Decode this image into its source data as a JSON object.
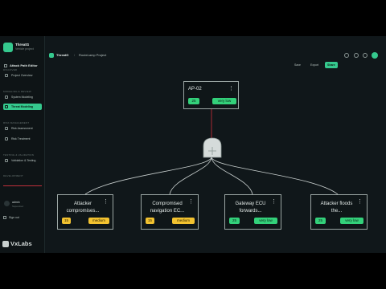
{
  "app": {
    "name": "ThreatG",
    "workspace": "Vehicle project"
  },
  "sidebar": {
    "sections": [
      {
        "label": "DISCOVER",
        "items": [
          {
            "label": "Project Overview",
            "icon": "grid-icon"
          }
        ]
      },
      {
        "label": "MODELING & REVIEW",
        "items": [
          {
            "label": "System Modeling",
            "icon": "cube-icon"
          },
          {
            "label": "Threat Modeling",
            "icon": "shield-icon",
            "active": true
          }
        ]
      },
      {
        "label": "RISK MANAGEMENT",
        "items": [
          {
            "label": "Risk Assessment",
            "icon": "chart-icon"
          },
          {
            "label": "Risk Treatment",
            "icon": "check-icon"
          }
        ]
      },
      {
        "label": "TESTING & VALIDATION",
        "items": [
          {
            "label": "Validation & Testing",
            "icon": "flask-icon"
          }
        ]
      },
      {
        "label": "DEVELOPMENT",
        "items": []
      }
    ],
    "user": {
      "name": "admin",
      "role": "Supervisor"
    },
    "signout": "Sign out"
  },
  "topbar": {
    "app": "ThreatG",
    "separator": "/",
    "project": "RouteLamp Project"
  },
  "editor": {
    "title": "Attack Path Editor",
    "buttons": {
      "save": "Save",
      "export": "Export",
      "share": "Share"
    }
  },
  "nodes": {
    "root": {
      "title": "AP-02",
      "score": "25",
      "rating": "very low"
    },
    "children": [
      {
        "title_line1": "Attacker",
        "title_line2": "compromises...",
        "score": "15",
        "rating": "medium"
      },
      {
        "title_line1": "Compromised",
        "title_line2": "navigation EC...",
        "score": "15",
        "rating": "medium"
      },
      {
        "title_line1": "Gateway ECU",
        "title_line2": "forwards...",
        "score": "25",
        "rating": "very low"
      },
      {
        "title_line1": "Attacker floods",
        "title_line2": "the...",
        "score": "25",
        "rating": "very low"
      }
    ],
    "gate": {
      "type": "and-gate-icon"
    },
    "menu_glyph": "⋮"
  },
  "watermark": "VxLabs",
  "colors": {
    "accent": "#35c98e",
    "medium": "#f2c230",
    "very_low": "#33d17a",
    "edge_root": "#d0303a",
    "edge_child": "#c8cfce"
  }
}
